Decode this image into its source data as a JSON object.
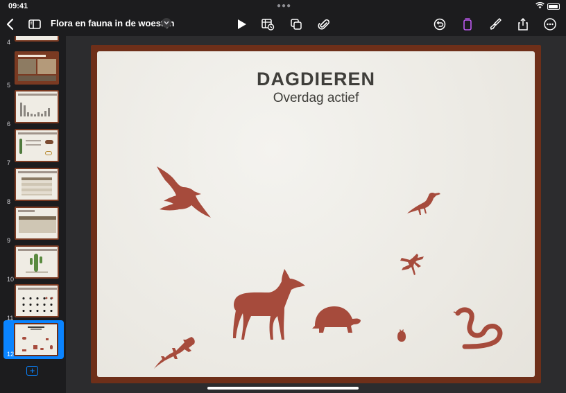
{
  "status": {
    "time": "09:41"
  },
  "toolbar": {
    "title": "Flora en fauna in de woestijn"
  },
  "sidebar": {
    "slides": [
      {
        "number": "4"
      },
      {
        "number": "5"
      },
      {
        "number": "6"
      },
      {
        "number": "7"
      },
      {
        "number": "8"
      },
      {
        "number": "9"
      },
      {
        "number": "10"
      },
      {
        "number": "11"
      },
      {
        "number": "12",
        "selected": true
      }
    ]
  },
  "slide": {
    "title": "DAGDIEREN",
    "subtitle": "Overdag actief"
  },
  "colors": {
    "accent": "#0a84ff",
    "frame": "#6e2f19",
    "animal": "#a64b3c",
    "paper": "#eeede8"
  }
}
